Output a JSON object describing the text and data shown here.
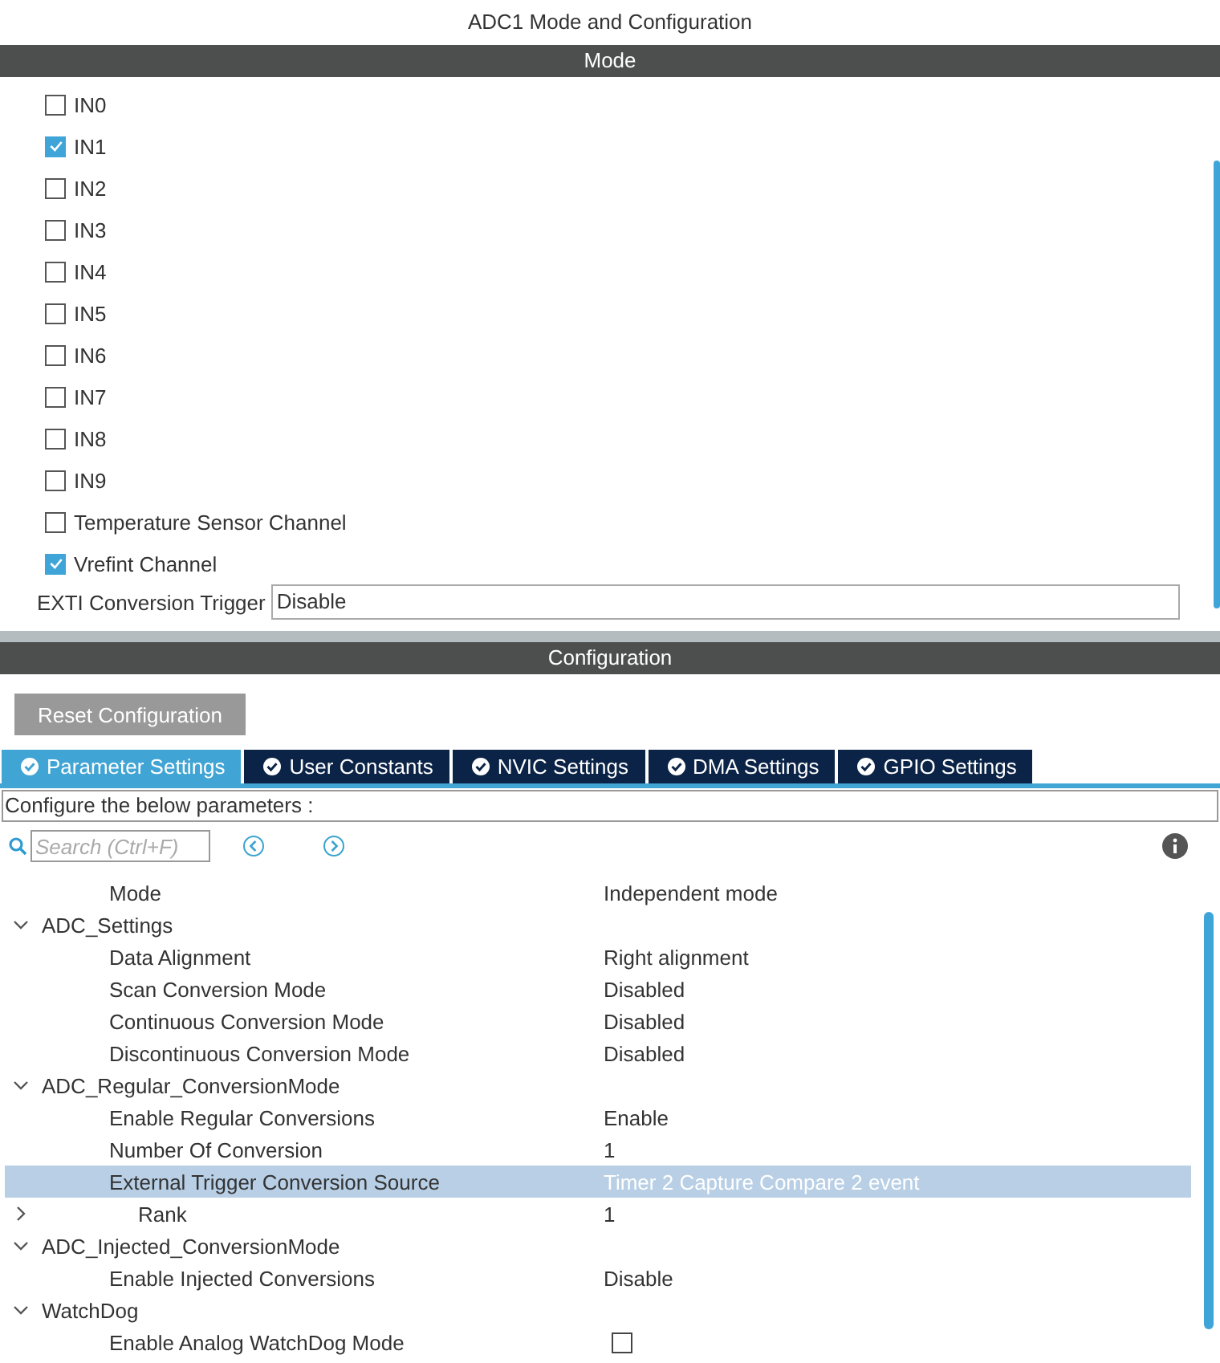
{
  "window": {
    "title": "ADC1 Mode and Configuration"
  },
  "mode": {
    "header": "Mode",
    "channels": [
      {
        "label": "IN0",
        "checked": false
      },
      {
        "label": "IN1",
        "checked": true
      },
      {
        "label": "IN2",
        "checked": false
      },
      {
        "label": "IN3",
        "checked": false
      },
      {
        "label": "IN4",
        "checked": false
      },
      {
        "label": "IN5",
        "checked": false
      },
      {
        "label": "IN6",
        "checked": false
      },
      {
        "label": "IN7",
        "checked": false
      },
      {
        "label": "IN8",
        "checked": false
      },
      {
        "label": "IN9",
        "checked": false
      },
      {
        "label": "Temperature Sensor Channel",
        "checked": false
      },
      {
        "label": "Vrefint Channel",
        "checked": true
      }
    ],
    "exti": {
      "label": "EXTI Conversion Trigger",
      "value": "Disable"
    }
  },
  "configuration": {
    "header": "Configuration",
    "reset_button": "Reset Configuration",
    "tabs": [
      {
        "label": "Parameter Settings",
        "selected": true
      },
      {
        "label": "User Constants",
        "selected": false
      },
      {
        "label": "NVIC Settings",
        "selected": false
      },
      {
        "label": "DMA Settings",
        "selected": false
      },
      {
        "label": "GPIO Settings",
        "selected": false
      }
    ],
    "hint": "Configure the below parameters :",
    "search": {
      "placeholder": "Search (Ctrl+F)"
    },
    "parameters": [
      {
        "name": "Mode",
        "value": "Independent mode",
        "selected": false
      },
      {
        "name": "ADC_Settings",
        "expanded": true,
        "selected": false,
        "children": [
          {
            "name": "Data Alignment",
            "value": "Right alignment",
            "selected": false
          },
          {
            "name": "Scan Conversion Mode",
            "value": "Disabled",
            "selected": false
          },
          {
            "name": "Continuous Conversion Mode",
            "value": "Disabled",
            "selected": false
          },
          {
            "name": "Discontinuous Conversion Mode",
            "value": "Disabled",
            "selected": false
          }
        ]
      },
      {
        "name": "ADC_Regular_ConversionMode",
        "expanded": true,
        "selected": false,
        "children": [
          {
            "name": "Enable Regular Conversions",
            "value": "Enable",
            "selected": false
          },
          {
            "name": "Number Of Conversion",
            "value": "1",
            "selected": false
          },
          {
            "name": "External Trigger Conversion Source",
            "value": "Timer 2 Capture Compare 2 event",
            "selected": true
          },
          {
            "name": "Rank",
            "value": "1",
            "expanded": false,
            "selected": false
          }
        ]
      },
      {
        "name": "ADC_Injected_ConversionMode",
        "expanded": true,
        "selected": false,
        "children": [
          {
            "name": "Enable Injected Conversions",
            "value": "Disable",
            "selected": false
          }
        ]
      },
      {
        "name": "WatchDog",
        "expanded": true,
        "selected": false,
        "children": [
          {
            "name": "Enable Analog WatchDog Mode",
            "kind": "checkbox",
            "checked": false,
            "selected": false
          }
        ]
      }
    ]
  }
}
